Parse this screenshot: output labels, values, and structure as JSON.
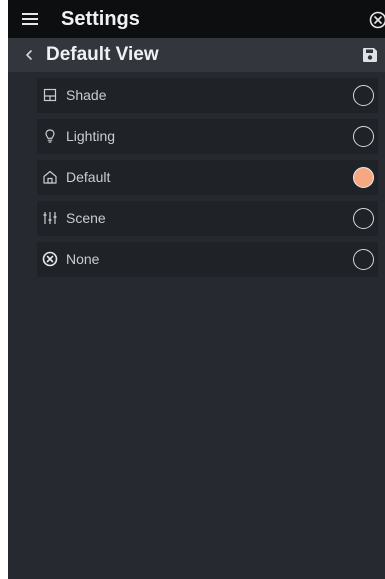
{
  "header": {
    "title": "Settings",
    "menu_icon": "hamburger-menu-icon",
    "close_icon": "close-circle-icon"
  },
  "subheader": {
    "title": "Default View",
    "back_icon": "chevron-left-icon",
    "save_icon": "save-floppy-icon"
  },
  "options": [
    {
      "label": "Shade",
      "icon": "shade-window-icon",
      "selected": false
    },
    {
      "label": "Lighting",
      "icon": "lightbulb-icon",
      "selected": false
    },
    {
      "label": "Default",
      "icon": "home-icon",
      "selected": true
    },
    {
      "label": "Scene",
      "icon": "sliders-scene-icon",
      "selected": false
    },
    {
      "label": "None",
      "icon": "x-circle-icon",
      "selected": false
    }
  ],
  "colors": {
    "selected_radio": "#f7a882",
    "background": "#262a30",
    "topbar": "#0d0e10"
  }
}
